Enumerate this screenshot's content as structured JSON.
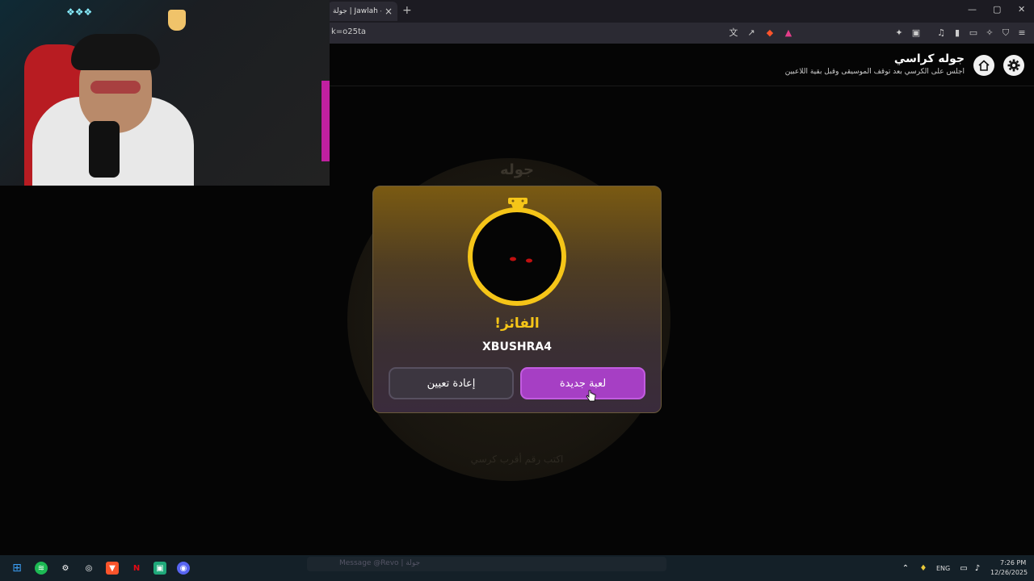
{
  "browser": {
    "tab_title": "جولة | Jawlah - مـ",
    "tab_close": "×",
    "new_tab": "+",
    "url": "k=o25ta",
    "window_controls": [
      "—",
      "▢",
      "✕"
    ]
  },
  "header": {
    "title": "جوله كراسي",
    "subtitle": "اجلس على الكرسي بعد توقف الموسيقى وقبل بقية اللاعبين",
    "home_icon": "home-icon",
    "settings_icon": "gear-icon"
  },
  "background": {
    "faint_title": "جوله",
    "faint_hint": "اكتب رقم أقرب كرسي"
  },
  "modal": {
    "winner_label": "الفائز!",
    "winner_name": "XBUSHRA4",
    "new_game_button": "لعبة جديدة",
    "reset_button": "إعادة تعيين",
    "accent_color": "#f5c518",
    "primary_button_color": "#a63fc4"
  },
  "taskbar": {
    "message_placeholder": "Message @Revo | جولة",
    "language": "ENG",
    "time": "7:26 PM",
    "date": "12/26/2025"
  }
}
